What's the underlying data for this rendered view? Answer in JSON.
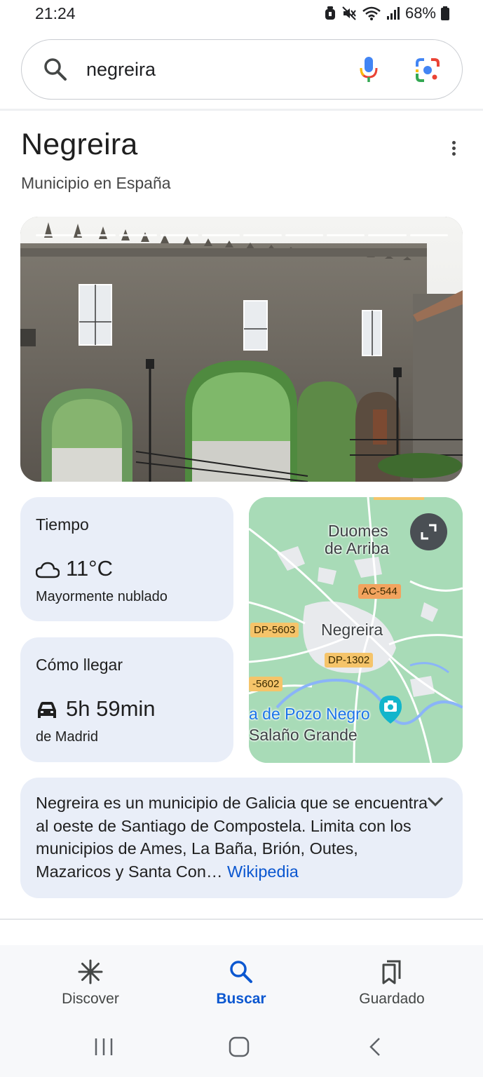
{
  "status_bar": {
    "time": "21:24",
    "battery": "68%",
    "icons": [
      "alarm-icon",
      "mute-icon",
      "wifi-icon",
      "signal-icon",
      "battery-icon"
    ]
  },
  "search": {
    "query": "negreira",
    "icons": [
      "search-icon",
      "mic-icon",
      "lens-icon"
    ]
  },
  "knowledge_panel": {
    "title": "Negreira",
    "subtitle": "Municipio en España",
    "image_progress_segments": 10
  },
  "weather": {
    "title": "Tiempo",
    "temperature": "11°C",
    "condition": "Mayormente nublado",
    "icon": "cloud-icon"
  },
  "route": {
    "title": "Cómo llegar",
    "duration": "5h 59min",
    "origin": "de Madrid",
    "icon": "car-icon"
  },
  "map": {
    "labels": {
      "duomes_line1": "Duomes",
      "duomes_line2": "de Arriba",
      "town": "Negreira",
      "poi_line1": "a de Pozo Negro",
      "poi_line2": "Salaño Grande"
    },
    "roads": {
      "ac544": "AC-544",
      "dp5603": "DP-5603",
      "dp1302": "DP-1302",
      "dp5602": "-5602"
    },
    "colors": {
      "land": "#a8dbb7",
      "urban": "#e8eaed",
      "water": "#8ab4f8",
      "road_badge": "#f5c46a",
      "road_badge_orange": "#f2a35e"
    }
  },
  "description": {
    "text": "Negreira es un municipio de Galicia que se encuentra al oeste de Santiago de Compostela. Limita con los municipios de Ames, La Baña, Brión, Outes, Mazaricos y Santa Con…",
    "link": "Wikipedia"
  },
  "bottom_nav": {
    "items": [
      {
        "label": "Discover",
        "icon": "asterisk-icon",
        "active": false
      },
      {
        "label": "Buscar",
        "icon": "search-icon",
        "active": true
      },
      {
        "label": "Guardado",
        "icon": "bookmarks-icon",
        "active": false
      }
    ]
  },
  "accent_color": "#0b57d0"
}
